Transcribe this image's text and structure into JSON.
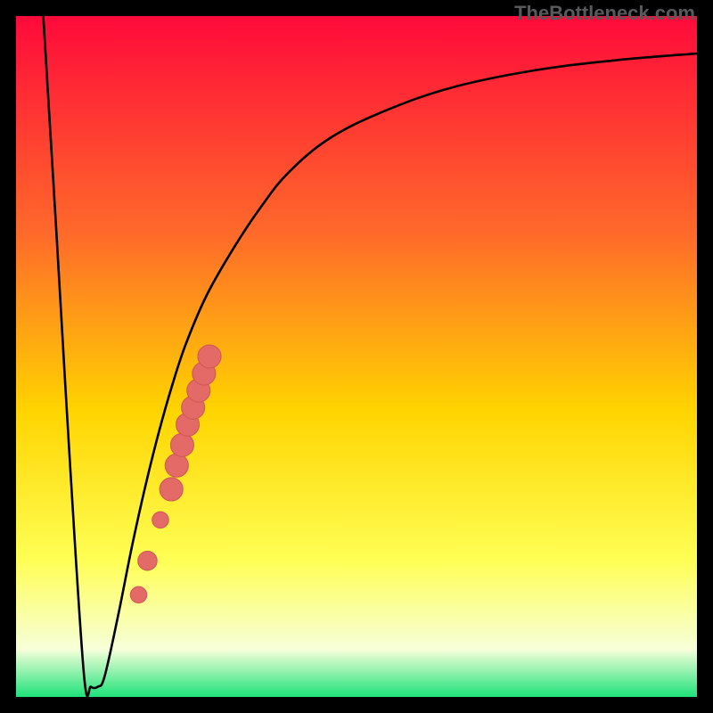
{
  "watermark": "TheBottleneck.com",
  "colors": {
    "gradient_top": "#ff0a3a",
    "gradient_mid1": "#ff6a2a",
    "gradient_mid2": "#ffd400",
    "gradient_mid3": "#ffff55",
    "gradient_pale": "#f7ffd9",
    "gradient_bottom": "#1ee27a",
    "curve": "#000000",
    "marker_fill": "#e46a68",
    "marker_stroke": "#cf5a58"
  },
  "chart_data": {
    "type": "line",
    "title": "",
    "xlabel": "",
    "ylabel": "",
    "xlim": [
      0,
      100
    ],
    "ylim": [
      0,
      100
    ],
    "grid": false,
    "series": [
      {
        "name": "bottleneck-curve",
        "comment": "V-shaped curve: sharp descent ~x=4..10, notch bottom ~x=10..13, asymptotic rise toward ~y=95",
        "x": [
          4,
          6,
          8,
          10,
          11,
          12,
          13,
          15,
          17,
          19,
          21,
          23,
          25,
          28,
          32,
          36,
          40,
          46,
          54,
          64,
          76,
          88,
          100
        ],
        "y": [
          100,
          67,
          33,
          3,
          1.5,
          1.5,
          3,
          12,
          22,
          31,
          39,
          46,
          52,
          59,
          66,
          72,
          77,
          82,
          86,
          89.5,
          92,
          93.5,
          94.5
        ]
      }
    ],
    "markers": {
      "name": "highlighted-points",
      "comment": "Pinkish points on the rising branch near the notch",
      "points": [
        {
          "x": 18.0,
          "y": 15.0,
          "r": 1.2
        },
        {
          "x": 19.3,
          "y": 20.0,
          "r": 1.4
        },
        {
          "x": 21.2,
          "y": 26.0,
          "r": 1.2
        },
        {
          "x": 22.8,
          "y": 30.5,
          "r": 1.7
        },
        {
          "x": 23.6,
          "y": 34.0,
          "r": 1.7
        },
        {
          "x": 24.4,
          "y": 37.0,
          "r": 1.7
        },
        {
          "x": 25.2,
          "y": 40.0,
          "r": 1.7
        },
        {
          "x": 26.0,
          "y": 42.5,
          "r": 1.7
        },
        {
          "x": 26.8,
          "y": 45.0,
          "r": 1.7
        },
        {
          "x": 27.6,
          "y": 47.5,
          "r": 1.7
        },
        {
          "x": 28.4,
          "y": 50.0,
          "r": 1.7
        }
      ]
    }
  }
}
